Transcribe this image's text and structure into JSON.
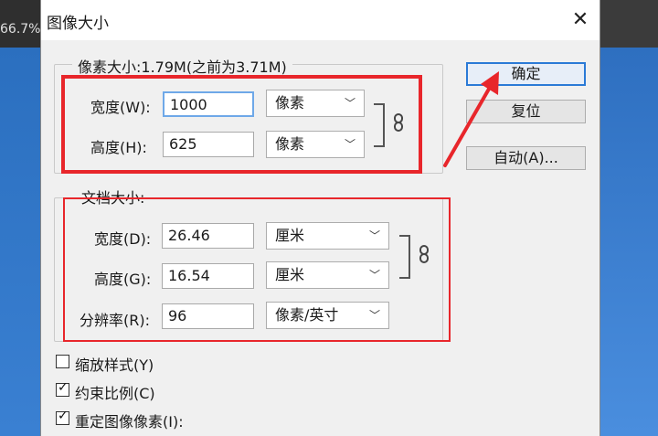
{
  "background": {
    "zoom_text": "66.7%"
  },
  "dialog": {
    "title": "图像大小",
    "close_glyph": "✕",
    "pixel_dimensions": {
      "legend": "像素大小:1.79M(之前为3.71M)",
      "width_label": "宽度(W):",
      "width_value": "1000",
      "width_unit": "像素",
      "height_label": "高度(H):",
      "height_value": "625",
      "height_unit": "像素"
    },
    "document_size": {
      "legend": "文档大小:",
      "width_label": "宽度(D):",
      "width_value": "26.46",
      "width_unit": "厘米",
      "height_label": "高度(G):",
      "height_value": "16.54",
      "height_unit": "厘米",
      "resolution_label": "分辨率(R):",
      "resolution_value": "96",
      "resolution_unit": "像素/英寸"
    },
    "buttons": {
      "ok": "确定",
      "reset": "复位",
      "auto": "自动(A)..."
    },
    "checkboxes": [
      {
        "label": "缩放样式(Y)",
        "checked": false
      },
      {
        "label": "约束比例(C)",
        "checked": true
      },
      {
        "label": "重定图像像素(I):",
        "checked": true
      }
    ],
    "check_glyph": "✓"
  },
  "colors": {
    "annotation_red": "#e8262b",
    "default_button_blue": "#2b7ad6"
  }
}
